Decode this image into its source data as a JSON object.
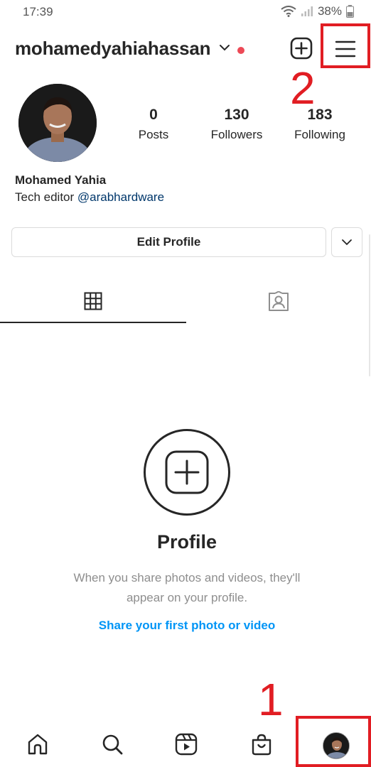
{
  "status_bar": {
    "time": "17:39",
    "battery": "38%"
  },
  "header": {
    "username": "mohamedyahiahassan",
    "icons": [
      "chevron-down-icon",
      "notification-dot",
      "new-post-plus-icon",
      "hamburger-menu-icon"
    ]
  },
  "profile": {
    "stats": [
      {
        "value": "0",
        "label": "Posts"
      },
      {
        "value": "130",
        "label": "Followers"
      },
      {
        "value": "183",
        "label": "Following"
      }
    ],
    "name": "Mohamed Yahia",
    "bio_prefix": "Tech editor ",
    "bio_link": "@arabhardware"
  },
  "actions": {
    "edit_profile": "Edit Profile"
  },
  "tabs": [
    "grid-icon",
    "tagged-icon"
  ],
  "empty_state": {
    "title": "Profile",
    "description": "When you share photos and videos, they'll appear on your profile.",
    "cta": "Share your first photo or video"
  },
  "annotations": {
    "label_1": "1",
    "label_2": "2",
    "color": "#e11d23"
  },
  "bottom_nav": [
    "home-icon",
    "search-icon",
    "reels-icon",
    "shop-icon",
    "profile-avatar"
  ],
  "colors": {
    "text": "#262626",
    "secondary": "#8e8e8e",
    "link": "#0095f6",
    "bio_link": "#00376b",
    "notification": "#ed4956"
  }
}
